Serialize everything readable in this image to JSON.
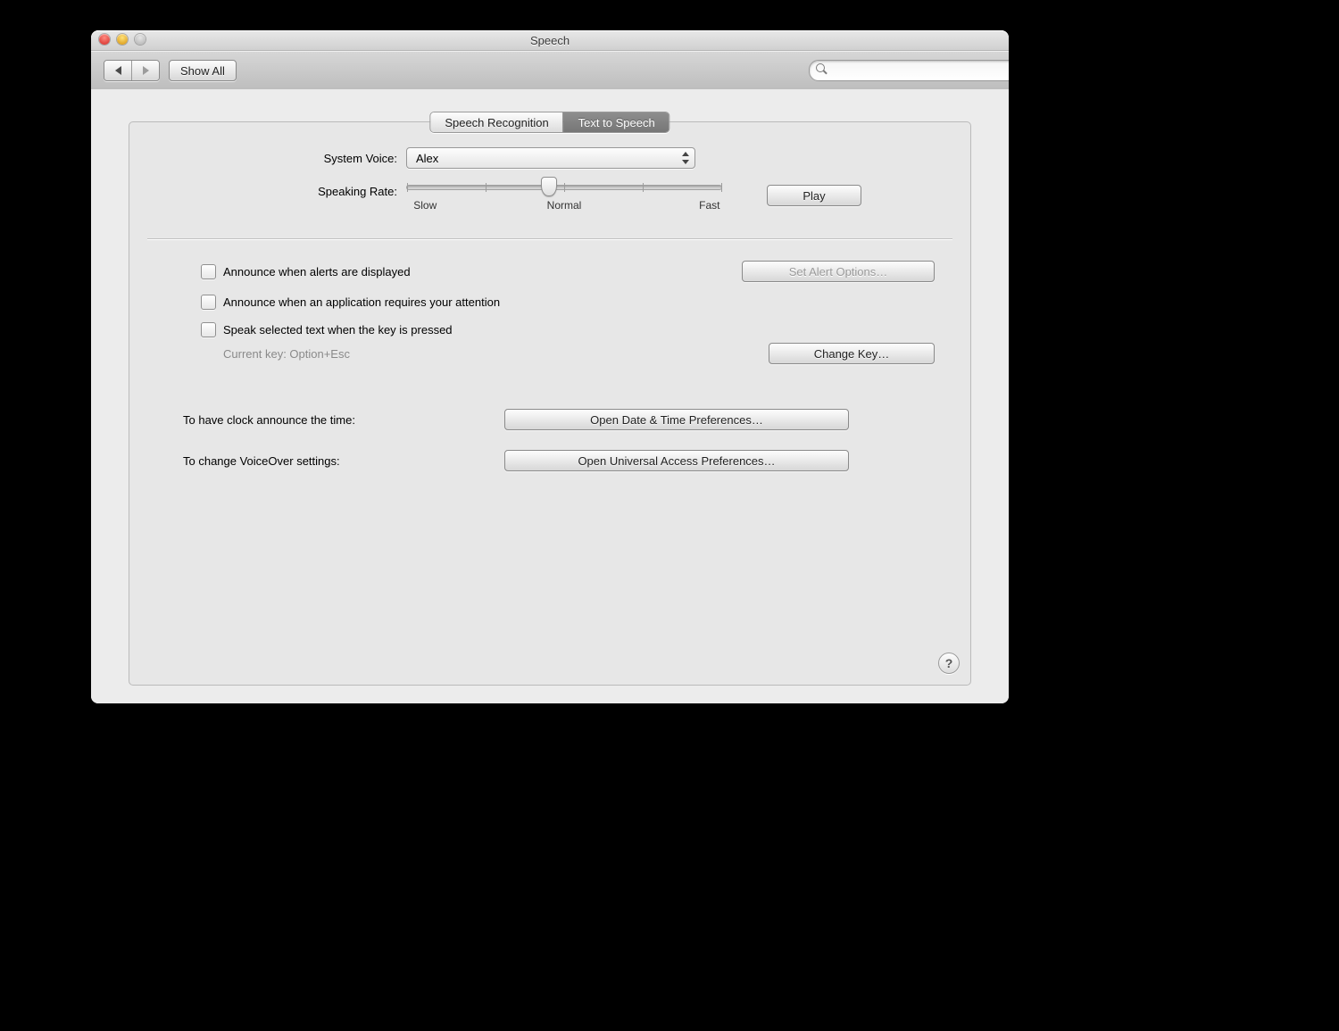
{
  "window": {
    "title": "Speech"
  },
  "toolbar": {
    "show_all": "Show All",
    "search_placeholder": ""
  },
  "tabs": {
    "speech_recognition": "Speech Recognition",
    "text_to_speech": "Text to Speech",
    "active": "text_to_speech"
  },
  "voice": {
    "label": "System Voice:",
    "value": "Alex"
  },
  "rate": {
    "label": "Speaking Rate:",
    "slow": "Slow",
    "normal": "Normal",
    "fast": "Fast",
    "value_percent": 45
  },
  "play_button": "Play",
  "announce_alerts": {
    "label": "Announce when alerts are displayed",
    "checked": false,
    "button": "Set Alert Options…",
    "button_enabled": false
  },
  "announce_attention": {
    "label": "Announce when an application requires your attention",
    "checked": false
  },
  "speak_selected": {
    "label": "Speak selected text when the key is pressed",
    "checked": false,
    "current_key_label": "Current key: Option+Esc",
    "change_key_button": "Change Key…"
  },
  "clock": {
    "label": "To have clock announce the time:",
    "button": "Open Date & Time Preferences…"
  },
  "voiceover": {
    "label": "To change VoiceOver settings:",
    "button": "Open Universal Access Preferences…"
  },
  "help": "?"
}
